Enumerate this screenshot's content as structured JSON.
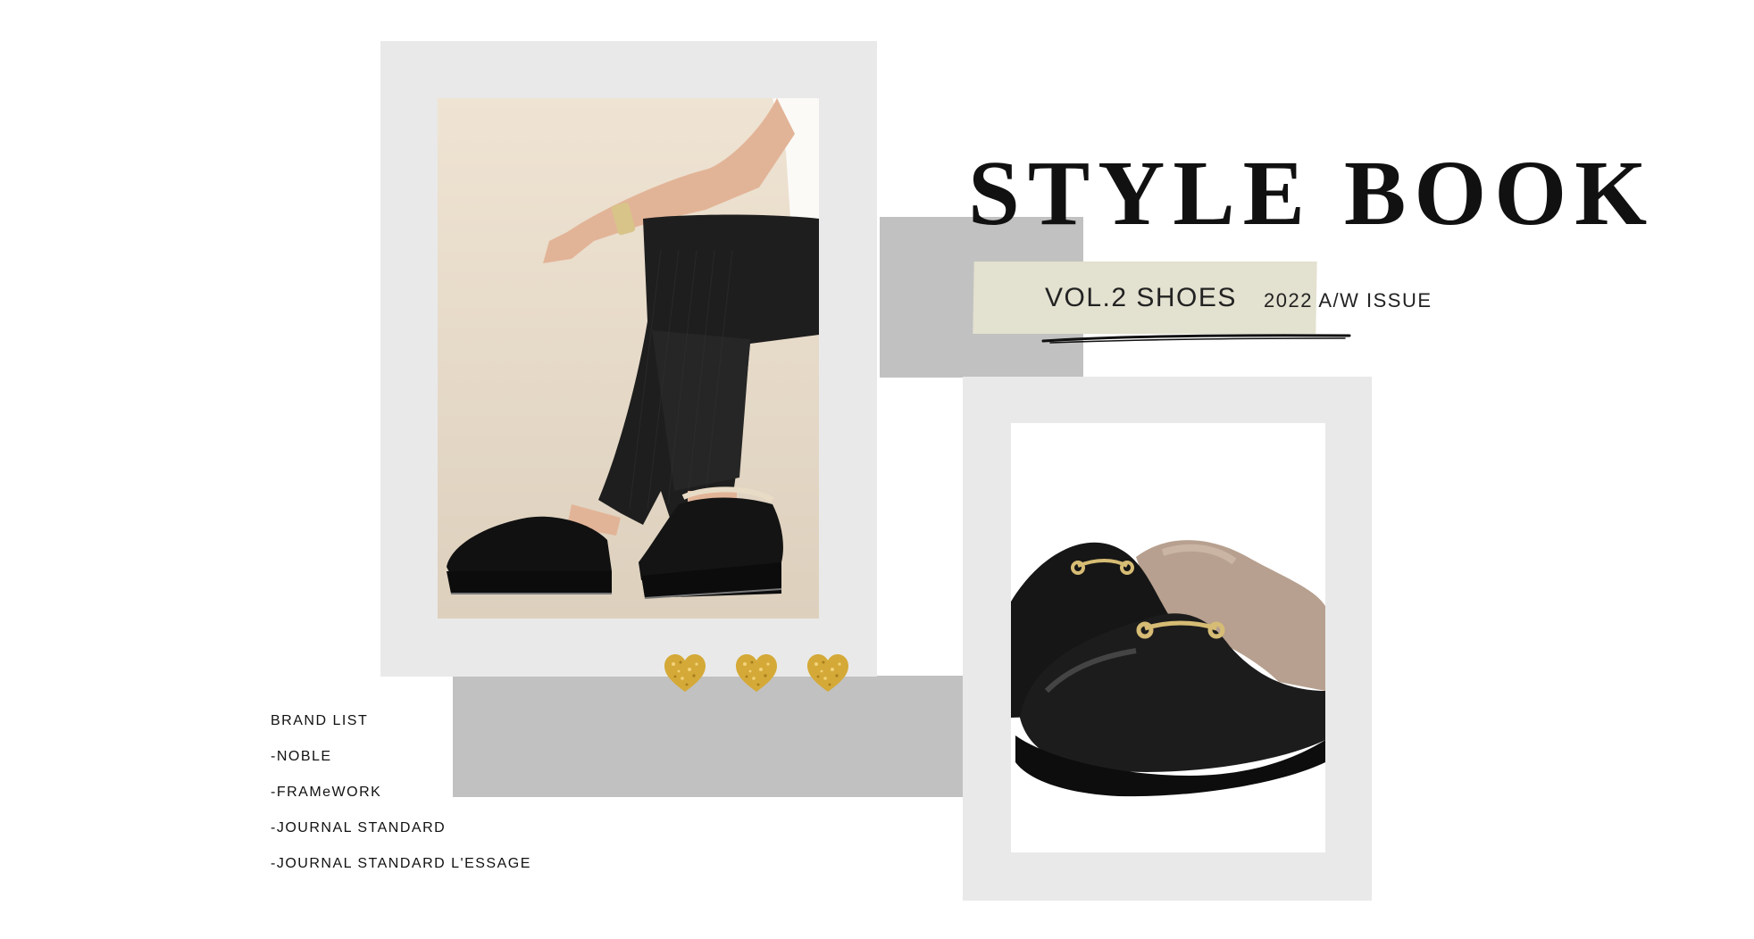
{
  "header": {
    "title": "STYLE BOOK",
    "volume": "VOL.2 SHOES",
    "issue": "2022 A/W ISSUE"
  },
  "brand_list": {
    "heading": "BRAND LIST",
    "items": [
      "-NOBLE",
      "-FRAMeWORK",
      "-JOURNAL STANDARD",
      "-JOURNAL STANDARD L'ESSAGE"
    ]
  },
  "images": {
    "left_photo": "model-wearing-black-suede-mules-photo",
    "right_photo": "black-leather-fur-lined-loafer-mule-photo"
  },
  "decorations": {
    "hearts": [
      "gold-glitter-heart-icon",
      "gold-glitter-heart-icon",
      "gold-glitter-heart-icon"
    ]
  },
  "colors": {
    "frame": "#e9e9e9",
    "grey_block": "#c1c1c1",
    "tape": "#e3e1cf",
    "gold": "#d4a937",
    "text": "#111111"
  }
}
